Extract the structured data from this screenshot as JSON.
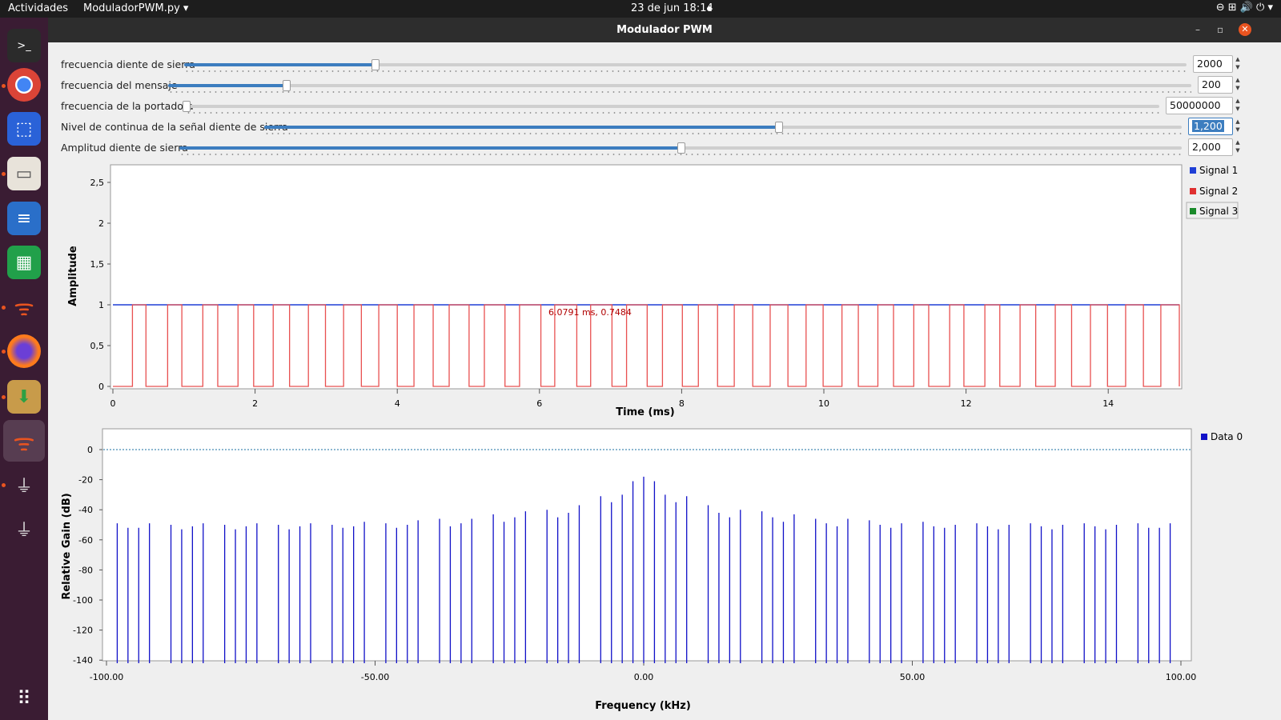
{
  "topbar": {
    "activities": "Actividades",
    "app_menu": "ModuladorPWM.py ▾",
    "datetime": "23 de jun  18:14",
    "tray": "⊖   ⊞  🔊  ⏻  ▾"
  },
  "window": {
    "title": "Modulador PWM",
    "minimize": "–",
    "maximize": "▫",
    "close": "✕"
  },
  "controls": [
    {
      "label": "frecuencia diente de sierra",
      "value": "2000",
      "level": 0.19
    },
    {
      "label": "frecuencia del mensaje",
      "value": "200",
      "level": 0.115
    },
    {
      "label": "frecuencia de la portadora",
      "value": "50000000",
      "level": 0.0
    },
    {
      "label": "Nivel de continua de la señal diente de sierra",
      "value": "1,200",
      "level": 0.56
    },
    {
      "label": "Amplitud diente de sierra",
      "value": "2,000",
      "level": 0.5
    }
  ],
  "time_plot": {
    "ylabel": "Amplitude",
    "xlabel": "Time (ms)",
    "cursor_readout": "6.0791 ms, 0.7484",
    "yticks": [
      "0",
      "0,5",
      "1",
      "1,5",
      "2",
      "2,5"
    ],
    "xticks": [
      "0",
      "2",
      "4",
      "6",
      "8",
      "10",
      "12",
      "14"
    ],
    "legend": [
      "Signal 1",
      "Signal 2",
      "Signal 3"
    ]
  },
  "freq_plot": {
    "ylabel": "Relative Gain (dB)",
    "xlabel": "Frequency (kHz)",
    "yticks": [
      "0",
      "-20",
      "-40",
      "-60",
      "-80",
      "-100",
      "-120",
      "-140"
    ],
    "xticks": [
      "-100.00",
      "-50.00",
      "0.00",
      "50.00",
      "100.00"
    ],
    "legend": [
      "Data 0"
    ]
  },
  "chart_data": [
    {
      "type": "line",
      "title": "",
      "xlabel": "Time (ms)",
      "ylabel": "Amplitude",
      "xlim": [
        0,
        15
      ],
      "ylim": [
        0,
        2.6
      ],
      "series": [
        {
          "name": "Signal 1",
          "color": "#1f3fd6",
          "values": "constant 1.0"
        },
        {
          "name": "Signal 2",
          "color": "#e85050",
          "pwm_period_ms": 0.5,
          "low": 0,
          "high": 1,
          "duty_cycles": [
            0.38,
            0.4,
            0.42,
            0.44,
            0.46,
            0.48,
            0.5,
            0.52,
            0.54,
            0.56,
            0.58,
            0.6,
            0.62,
            0.6,
            0.58,
            0.56,
            0.54,
            0.52,
            0.5,
            0.48,
            0.46,
            0.44,
            0.42,
            0.4,
            0.42,
            0.44,
            0.46,
            0.48,
            0.5,
            0.52
          ]
        },
        {
          "name": "Signal 3",
          "color": "#1a8a2a",
          "values": []
        }
      ]
    },
    {
      "type": "bar",
      "title": "",
      "xlabel": "Frequency (kHz)",
      "ylabel": "Relative Gain (dB)",
      "xlim": [
        -100,
        100
      ],
      "ylim": [
        -140,
        10
      ],
      "series": [
        {
          "name": "Data 0",
          "color": "#1010c8",
          "freqs_khz": [
            -98,
            -96,
            -94,
            -92,
            -88,
            -86,
            -84,
            -82,
            -78,
            -76,
            -74,
            -72,
            -68,
            -66,
            -64,
            -62,
            -58,
            -56,
            -54,
            -52,
            -48,
            -46,
            -44,
            -42,
            -38,
            -36,
            -34,
            -32,
            -28,
            -26,
            -24,
            -22,
            -18,
            -16,
            -14,
            -12,
            -8,
            -6,
            -4,
            -2,
            0,
            2,
            4,
            6,
            8,
            12,
            14,
            16,
            18,
            22,
            24,
            26,
            28,
            32,
            34,
            36,
            38,
            42,
            44,
            46,
            48,
            52,
            54,
            56,
            58,
            62,
            64,
            66,
            68,
            72,
            74,
            76,
            78,
            82,
            84,
            86,
            88,
            92,
            94,
            96,
            98
          ],
          "gain_db": [
            -49,
            -52,
            -52,
            -49,
            -50,
            -53,
            -51,
            -49,
            -50,
            -53,
            -51,
            -49,
            -50,
            -53,
            -51,
            -49,
            -50,
            -52,
            -51,
            -48,
            -49,
            -52,
            -50,
            -47,
            -46,
            -51,
            -49,
            -46,
            -43,
            -48,
            -45,
            -41,
            -40,
            -45,
            -42,
            -37,
            -31,
            -35,
            -30,
            -21,
            -18,
            -21,
            -30,
            -35,
            -31,
            -37,
            -42,
            -45,
            -40,
            -41,
            -45,
            -48,
            -43,
            -46,
            -49,
            -51,
            -46,
            -47,
            -50,
            -52,
            -49,
            -48,
            -51,
            -52,
            -50,
            -49,
            -51,
            -53,
            -50,
            -49,
            -51,
            -53,
            -50,
            -49,
            -51,
            -53,
            -50,
            -49,
            -52,
            -52,
            -49
          ]
        }
      ],
      "reference_line_db": 0
    }
  ]
}
